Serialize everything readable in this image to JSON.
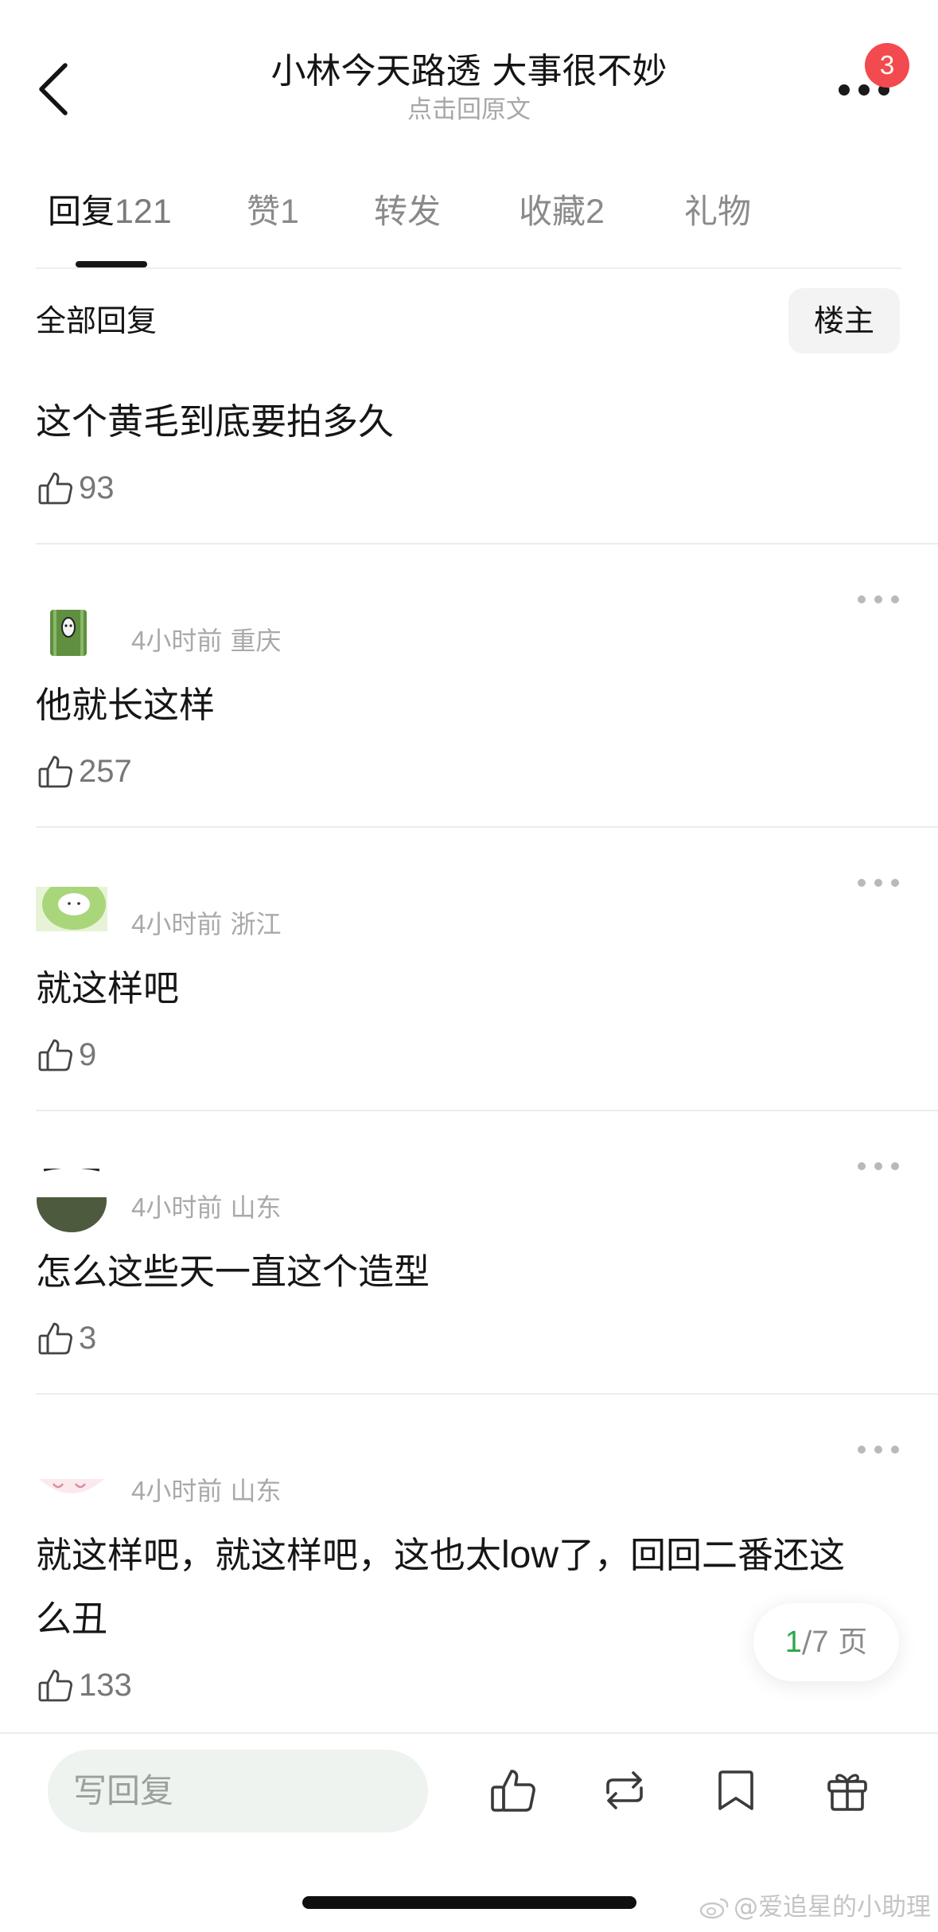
{
  "header": {
    "title": "小林今天路透 大事很不妙",
    "subtitle": "点击回原文",
    "notification_count": "3"
  },
  "tabs": [
    {
      "label": "回复",
      "count": "121",
      "active": true
    },
    {
      "label": "赞",
      "count": "1",
      "active": false
    },
    {
      "label": "转发",
      "count": "",
      "active": false
    },
    {
      "label": "收藏",
      "count": "2",
      "active": false
    },
    {
      "label": "礼物",
      "count": "",
      "active": false
    }
  ],
  "filter": {
    "label": "全部回复",
    "op_button": "楼主"
  },
  "comments": [
    {
      "text": "这个黄毛到底要拍多久",
      "likes": "93"
    },
    {
      "time": "4",
      "time_unit": "小时前",
      "location": "重庆",
      "text": "他就长这样",
      "likes": "257"
    },
    {
      "time": "4",
      "time_unit": "小时前",
      "location": "浙江",
      "text": "就这样吧",
      "likes": "9"
    },
    {
      "time": "4",
      "time_unit": "小时前",
      "location": "山东",
      "text": "怎么这些天一直这个造型",
      "likes": "3"
    },
    {
      "time": "4",
      "time_unit": "小时前",
      "location": "山东",
      "text_line1_a": "就这样吧，就这样吧，这也太",
      "text_line1_b": "low",
      "text_line1_c": "了，回回二番还这",
      "text_line2": "么丑",
      "likes": "133"
    }
  ],
  "pagination": {
    "current": "1",
    "total": "7",
    "unit": "页"
  },
  "bottom_bar": {
    "reply_placeholder": "写回复"
  },
  "watermark": "@爱追星的小助理",
  "colors": {
    "badge": "#f24a4f",
    "page_current": "#2ea64a",
    "reply_input_bg": "#eef3ef"
  }
}
